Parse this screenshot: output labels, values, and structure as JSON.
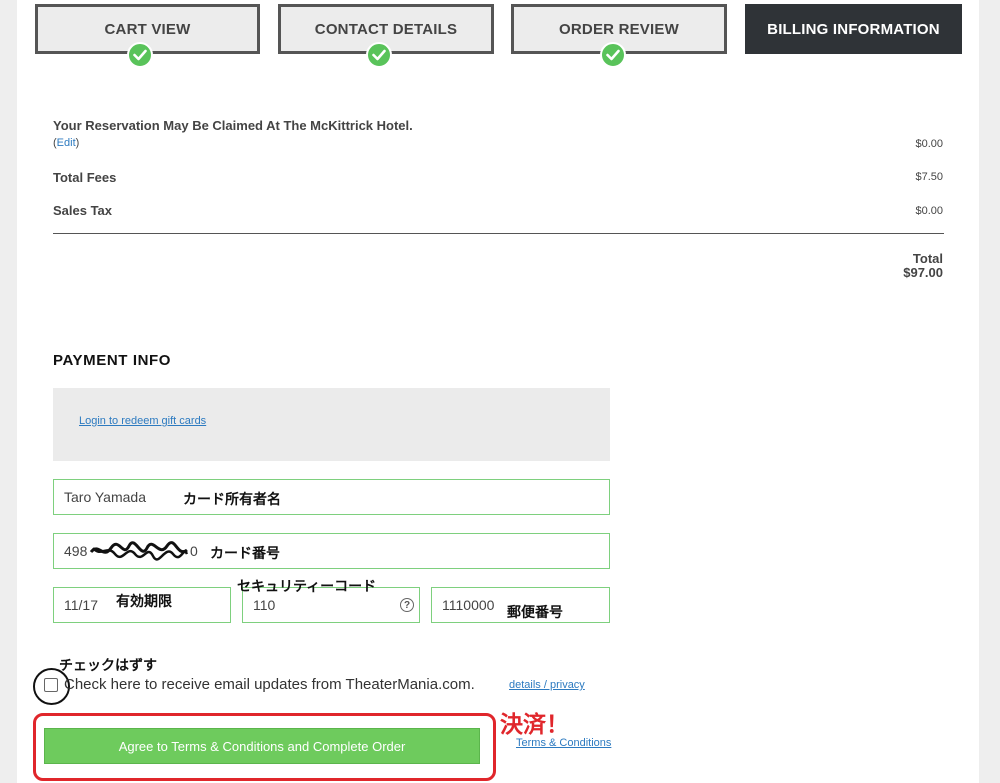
{
  "steps": [
    {
      "label": "CART VIEW",
      "state": "complete"
    },
    {
      "label": "CONTACT DETAILS",
      "state": "complete"
    },
    {
      "label": "ORDER REVIEW",
      "state": "complete"
    },
    {
      "label": "BILLING INFORMATION",
      "state": "active"
    }
  ],
  "summary": {
    "reservation_text": "Your Reservation May Be Claimed At The McKittrick Hotel.",
    "edit_open": "(",
    "edit_label": "Edit",
    "edit_close": ")",
    "reservation_amount": "$0.00",
    "fees_label": "Total Fees",
    "fees_amount": "$7.50",
    "tax_label": "Sales Tax",
    "tax_amount": "$0.00",
    "total_label": "Total",
    "total_amount": "$97.00"
  },
  "payment": {
    "heading": "PAYMENT INFO",
    "gift_link": "Login to redeem gift cards",
    "cardholder_value": "Taro Yamada",
    "cardholder_anno": "カード所有者名",
    "card_number_value": "498",
    "card_number_tail": "0",
    "card_number_anno": "カード番号",
    "expiry_value": "11/17",
    "expiry_anno": "有効期限",
    "cvv_value": "110",
    "cvv_anno": "セキュリティーコード",
    "help_glyph": "?",
    "zip_value": "1110000",
    "zip_anno": "郵便番号"
  },
  "optin": {
    "anno": "チェックはずす",
    "label": "Check here to receive email updates from TheaterMania.com.",
    "link": "details / privacy"
  },
  "submit": {
    "button_label": "Agree to Terms & Conditions and Complete Order",
    "terms_link": "Terms & Conditions",
    "anno": "決済！"
  },
  "colors": {
    "accent_green": "#6ecb5d",
    "check_green": "#59c35a",
    "link_blue": "#2c7ac0",
    "annotation_red": "#e0262b",
    "active_step": "#2f3337"
  },
  "icons": {
    "step_check": "check-circle-icon",
    "help": "question-circle-icon"
  }
}
